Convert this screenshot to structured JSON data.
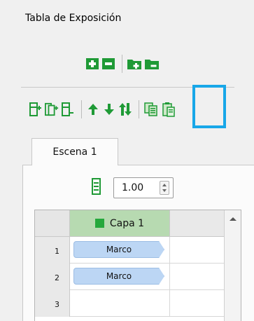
{
  "panel": {
    "title": "Tabla de Exposición"
  },
  "toolbar_top": {
    "buttons": [
      {
        "icon": "add-green-square-icon"
      },
      {
        "icon": "remove-green-square-icon"
      },
      {
        "icon": "add-folder-icon"
      },
      {
        "icon": "remove-folder-icon"
      }
    ]
  },
  "toolbar_bottom": {
    "buttons": [
      {
        "icon": "insert-frame-icon"
      },
      {
        "icon": "insert-frames-icon"
      },
      {
        "icon": "remove-frame-icon"
      },
      {
        "icon": "move-up-arrow-icon"
      },
      {
        "icon": "move-down-arrow-icon"
      },
      {
        "icon": "swap-arrows-icon"
      },
      {
        "icon": "copy-icon"
      },
      {
        "icon": "paste-icon"
      }
    ]
  },
  "tabs": [
    {
      "label": "Escena 1",
      "active": true
    }
  ],
  "zoom": {
    "value": "1.00"
  },
  "grid": {
    "layer_header": "Capa 1",
    "layer_color": "#25a83c",
    "rows": [
      {
        "num": "1",
        "cell": "Marco"
      },
      {
        "num": "2",
        "cell": "Marco"
      },
      {
        "num": "3",
        "cell": ""
      }
    ]
  },
  "colors": {
    "accent_highlight": "#18a7e8",
    "green_icon": "#25a83c",
    "chip_blue": "#bcd6f4",
    "header_green": "#b7dab1"
  }
}
